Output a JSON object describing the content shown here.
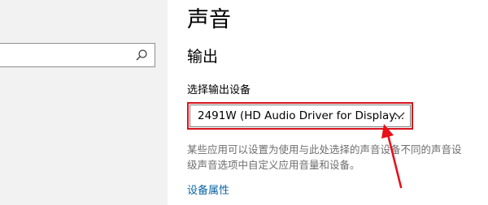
{
  "window": {
    "page_title": "声音"
  },
  "search": {
    "value": "",
    "placeholder": ""
  },
  "output": {
    "section_title": "输出",
    "select_label": "选择输出设备",
    "selected_device": "2491W (HD Audio Driver for Display...",
    "description_line1": "某些应用可以设置为使用与此处选择的声音设备不同的声音设",
    "description_line2": "级声音选项中自定义应用音量和设备。",
    "properties_link": "设备属性"
  },
  "icons": {
    "search": "search-icon",
    "dropdown": "chevron-down-icon",
    "annotation": "red-arrow-annotation"
  },
  "colors": {
    "highlight_border": "#d6131d",
    "annotation_arrow": "#e8101a",
    "link": "#0a64a4",
    "description_text": "#6e6e6e",
    "left_pane_bg": "#f2f2f2"
  }
}
